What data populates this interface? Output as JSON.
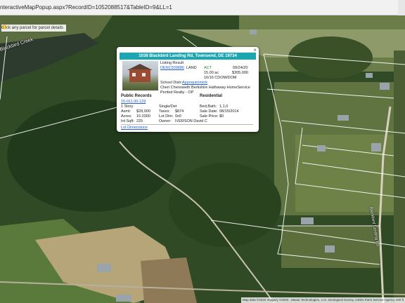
{
  "browser": {
    "url": "nteractiveMapPopup.aspx?RecordID=1052088517&TableID=9&LL=1"
  },
  "map": {
    "hint": "Click any parcel for parcel details",
    "labels": {
      "creek": "Blackbird Creek",
      "road": "Blackbird Landing Rd"
    },
    "attribution": "Map data ©2020 Imagery ©2020 , Maxar Technologies, U.S. Geological Survey, USDA Farm Service Agency  100 ft"
  },
  "popup": {
    "address": "1038 Blackbird Landing Rd, Townsend, DE 19734",
    "status_label": "Listing Result",
    "listing_id": "DENC509886",
    "type": "LAND",
    "status": "ACT",
    "date": "09/24/20",
    "acres": "15.00 ac",
    "price": "$305,000",
    "dom": "16/16 CDOM/DOM",
    "school_label": "School Distr:",
    "school": "Appoquinimink",
    "agent": "Cheri Chenoweth Berkshire Hathaway HomeService",
    "office": "Penfed Realty - OP",
    "public_records_title": "Public Records",
    "residential_title": "Residential",
    "parcel_id": "15-011.00-129",
    "story": "1 Story",
    "style": "Single/Det",
    "bed_bath_label": "Bed,Bath:",
    "bed_bath": "1,1,0",
    "asmt_label": "Asmt:",
    "asmt": "$28,000",
    "taxes_label": "Taxes:",
    "taxes": "$874",
    "sale_date_label": "Sale Date:",
    "sale_date": "08/15/2014",
    "acres_label": "Acres:",
    "acres_val": "15.0300",
    "lot_dim_label": "Lot Dim:",
    "lot_dim": "0x0",
    "sale_price_label": "Sale Price:",
    "sale_price": "$0",
    "int_sqft_label": "Int Sqft:",
    "int_sqft": "225",
    "owner_label": "Owner:",
    "owner": "IVERSON David C",
    "lot_dimensions_link": "Lot Dimensions",
    "close": "×"
  },
  "colors": {
    "header_teal": "#1aa6b2",
    "link_blue": "#1f5fd1"
  }
}
